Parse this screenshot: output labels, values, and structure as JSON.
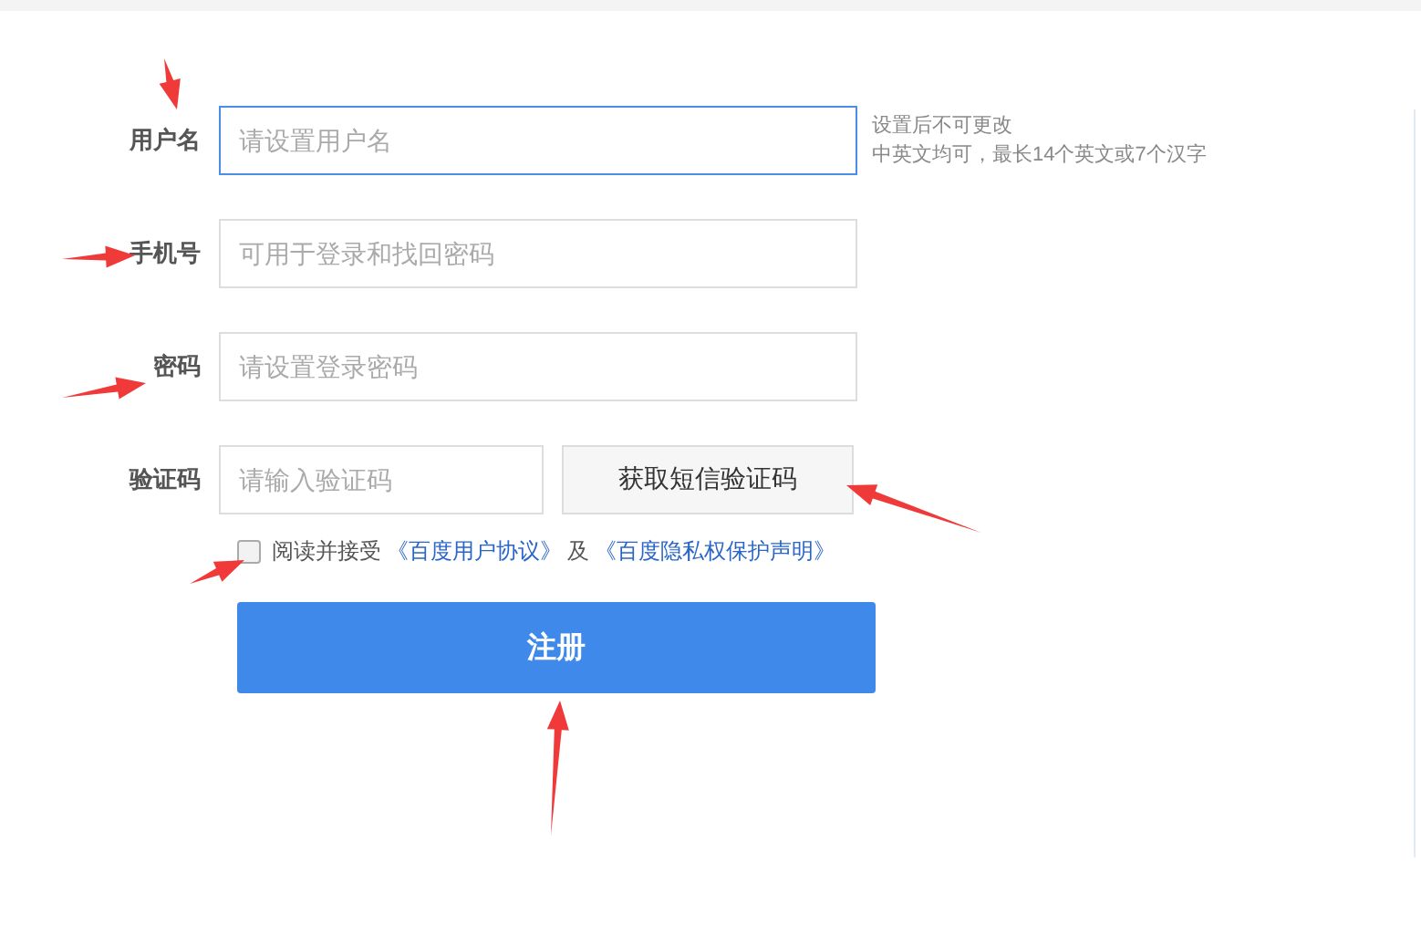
{
  "fields": [
    {
      "label": "用户名",
      "placeholder": "请设置用户名",
      "focused": true,
      "hint": [
        "设置后不可更改",
        "中英文均可，最长14个英文或7个汉字"
      ]
    },
    {
      "label": "手机号",
      "placeholder": "可用于登录和找回密码",
      "focused": false
    },
    {
      "label": "密码",
      "placeholder": "请设置登录密码",
      "focused": false
    }
  ],
  "verify": {
    "label": "验证码",
    "placeholder": "请输入验证码",
    "button": "获取短信验证码"
  },
  "agreement": {
    "checked": false,
    "text": "阅读并接受",
    "link1": "《百度用户协议》",
    "and": "及",
    "link2": "《百度隐私权保护声明》"
  },
  "submit": "注册"
}
